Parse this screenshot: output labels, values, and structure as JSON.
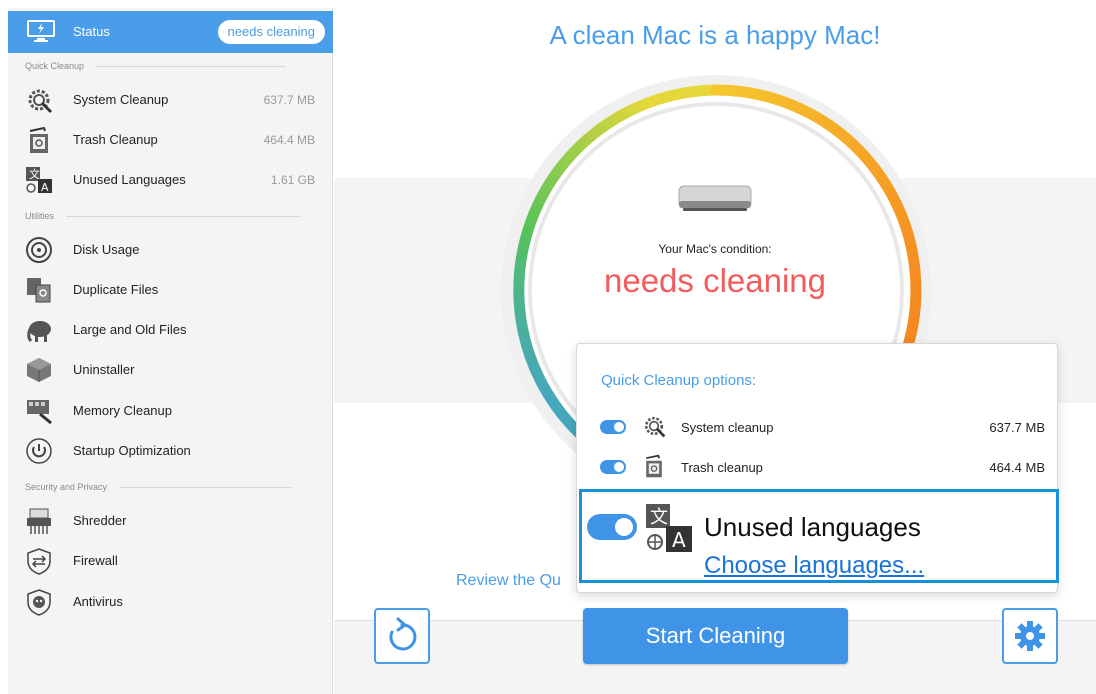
{
  "sidebar": {
    "status": {
      "label": "Status",
      "badge": "needs cleaning"
    },
    "sections": {
      "quick_cleanup": "Quick Cleanup",
      "utilities": "Utilities",
      "security": "Security and Privacy"
    },
    "quick_items": [
      {
        "label": "System Cleanup",
        "size": "637.7 MB",
        "icon": "system-cleanup-icon"
      },
      {
        "label": "Trash Cleanup",
        "size": "464.4 MB",
        "icon": "trash-icon"
      },
      {
        "label": "Unused Languages",
        "size": "1.61 GB",
        "icon": "languages-icon"
      }
    ],
    "utility_items": [
      {
        "label": "Disk Usage",
        "icon": "disk-usage-icon"
      },
      {
        "label": "Duplicate Files",
        "icon": "duplicate-files-icon"
      },
      {
        "label": "Large and Old Files",
        "icon": "elephant-icon"
      },
      {
        "label": "Uninstaller",
        "icon": "uninstaller-icon"
      },
      {
        "label": "Memory Cleanup",
        "icon": "memory-icon"
      },
      {
        "label": "Startup Optimization",
        "icon": "power-icon"
      }
    ],
    "security_items": [
      {
        "label": "Shredder",
        "icon": "shredder-icon"
      },
      {
        "label": "Firewall",
        "icon": "firewall-icon"
      },
      {
        "label": "Antivirus",
        "icon": "antivirus-icon"
      }
    ]
  },
  "main": {
    "headline": "A clean Mac is a happy Mac!",
    "condition_label": "Your Mac's condition:",
    "condition_value": "needs cleaning",
    "review_link": "Review the Qu",
    "start_button": "Start Cleaning"
  },
  "popover": {
    "title": "Quick Cleanup options:",
    "options": [
      {
        "label": "System cleanup",
        "size": "637.7 MB"
      },
      {
        "label": "Trash cleanup",
        "size": "464.4 MB"
      }
    ],
    "highlight": {
      "label": "Unused languages",
      "link": "Choose languages..."
    }
  },
  "colors": {
    "accent": "#4a9de8",
    "alert": "#f25c5c",
    "highlight_border": "#1a8fd8"
  }
}
